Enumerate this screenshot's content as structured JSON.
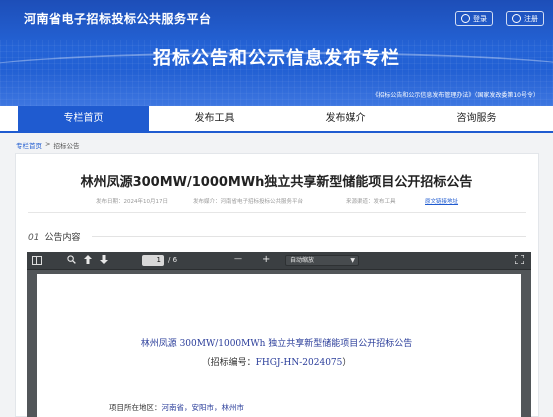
{
  "header": {
    "site_title": "河南省电子招标投标公共服务平台",
    "login_label": "登录",
    "register_label": "注册",
    "banner_title": "招标公告和公示信息发布专栏",
    "banner_note": "《招标公告和公示信息发布管理办法》（国家发改委第10号令）"
  },
  "nav": {
    "items": [
      {
        "label": "专栏首页",
        "active": true
      },
      {
        "label": "发布工具",
        "active": false
      },
      {
        "label": "发布媒介",
        "active": false
      },
      {
        "label": "咨询服务",
        "active": false
      }
    ]
  },
  "breadcrumb": {
    "home": "专栏首页",
    "separator": ">",
    "current": "招标公告"
  },
  "article": {
    "title": "林州凤源300MW/1000MWh独立共享新型储能项目公开招标公告",
    "publish_date": "发布日期：2024年10月17日",
    "publisher": "发布媒介：河南省电子招标投标公共服务平台",
    "source": "来源渠道：发布工具",
    "original_link": "原文链接地址"
  },
  "section": {
    "number": "01",
    "title": "公告内容"
  },
  "pdf_viewer": {
    "current_page": "1",
    "total_pages": "/ 6",
    "zoom_minus": "—",
    "zoom_plus": "+",
    "zoom_value": "自动缩放",
    "document": {
      "title": "林州凤源 300MW/1000MWh 独立共享新型储能项目公开招标公告",
      "code_prefix": "（招标编号：",
      "code_value": "FHGJ-HN-2024075",
      "code_suffix": "）",
      "location_label": "项目所在地区：",
      "location_value": "河南省，安阳市，林州市"
    }
  },
  "colors": {
    "primary": "#1f5bd0",
    "pdf_link": "#2a3d9a"
  }
}
